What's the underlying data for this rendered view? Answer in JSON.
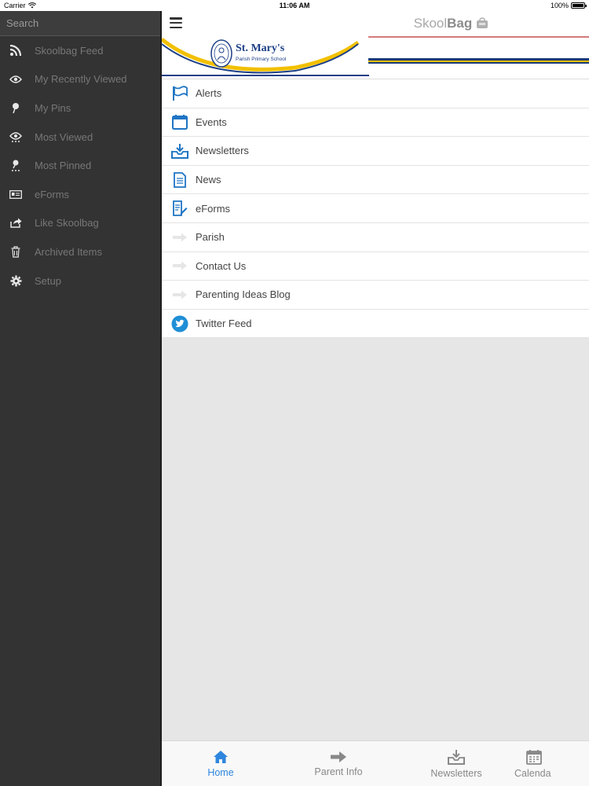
{
  "status_bar": {
    "carrier": "Carrier",
    "time": "11:06 AM",
    "battery": "100%"
  },
  "sidebar": {
    "search_placeholder": "Search",
    "items": [
      {
        "label": "Skoolbag Feed",
        "icon": "rss-icon"
      },
      {
        "label": "My Recently Viewed",
        "icon": "eye-icon"
      },
      {
        "label": "My Pins",
        "icon": "pin-icon"
      },
      {
        "label": "Most Viewed",
        "icon": "eye-dots-icon"
      },
      {
        "label": "Most Pinned",
        "icon": "pin-dots-icon"
      },
      {
        "label": "eForms",
        "icon": "id-card-icon"
      },
      {
        "label": "Like Skoolbag",
        "icon": "share-icon"
      },
      {
        "label": "Archived Items",
        "icon": "trash-icon"
      },
      {
        "label": "Setup",
        "icon": "gear-icon"
      }
    ]
  },
  "header": {
    "brand_light": "Skool",
    "brand_bold": "Bag"
  },
  "banner": {
    "school_name": "St. Mary's",
    "school_sub": "Parish Primary School"
  },
  "menu": {
    "items": [
      {
        "label": "Alerts",
        "icon": "flag-icon"
      },
      {
        "label": "Events",
        "icon": "calendar-icon"
      },
      {
        "label": "Newsletters",
        "icon": "inbox-download-icon"
      },
      {
        "label": "News",
        "icon": "document-icon"
      },
      {
        "label": "eForms",
        "icon": "form-pencil-icon"
      },
      {
        "label": "Parish",
        "icon": "arrow-right-icon"
      },
      {
        "label": "Contact Us",
        "icon": "arrow-right-icon"
      },
      {
        "label": "Parenting Ideas Blog",
        "icon": "arrow-right-icon"
      },
      {
        "label": "Twitter Feed",
        "icon": "twitter-icon"
      }
    ]
  },
  "tabbar": {
    "tabs": [
      {
        "label": "Home",
        "icon": "home-icon",
        "active": true
      },
      {
        "label": "Parent Info",
        "icon": "arrow-right-icon",
        "active": false
      },
      {
        "label": "Newsletters",
        "icon": "inbox-download-icon",
        "active": false
      },
      {
        "label": "Calenda",
        "icon": "calendar-icon",
        "active": false
      }
    ]
  },
  "colors": {
    "accent": "#2e86de",
    "sidebar_bg": "#333333",
    "school_navy": "#1c3f87",
    "school_gold": "#f2c000"
  }
}
